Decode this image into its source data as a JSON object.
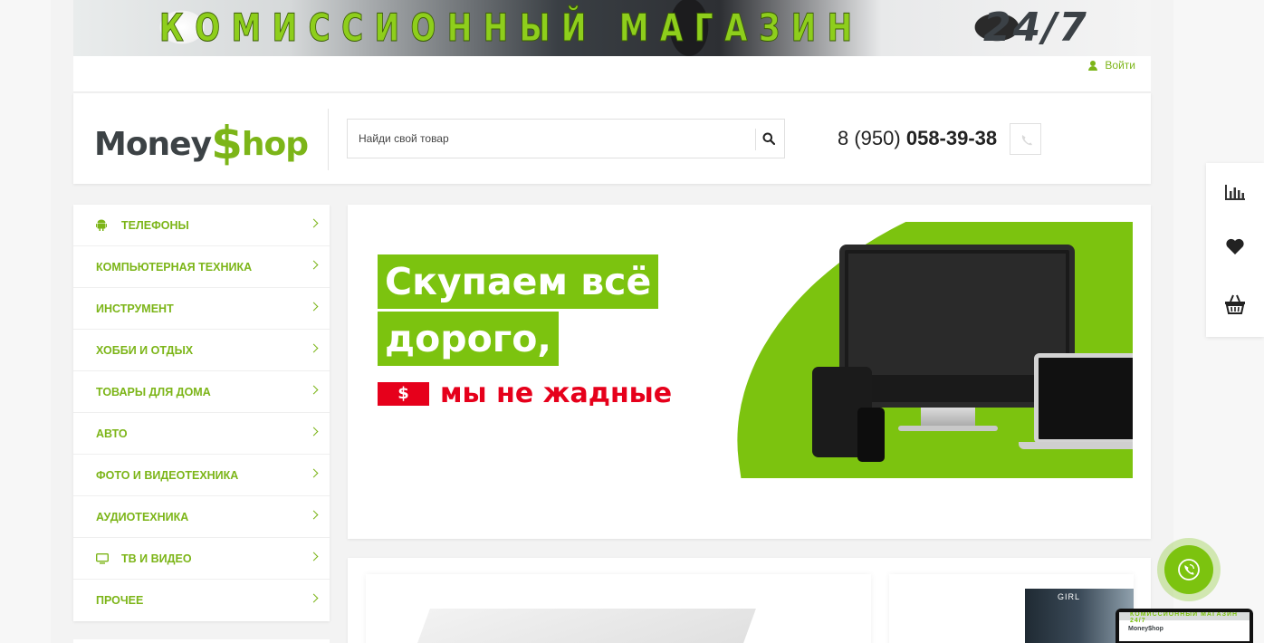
{
  "banner": {
    "title": "КОМИССИОННЫЙ МАГАЗИН",
    "hours": "24/7"
  },
  "topbar": {
    "login_label": "Войти"
  },
  "header": {
    "logo_money": "Money",
    "logo_dollar": "$",
    "logo_hop": "hop",
    "search_placeholder": "Найди свой товар",
    "phone_prefix": "8 (950)",
    "phone_main": "058-39-38"
  },
  "sidebar": {
    "items": [
      {
        "label": "ТЕЛЕФОНЫ",
        "icon": "android-icon"
      },
      {
        "label": "КОМПЬЮТЕРНАЯ ТЕХНИКА",
        "icon": ""
      },
      {
        "label": "ИНСТРУМЕНТ",
        "icon": ""
      },
      {
        "label": "ХОББИ И ОТДЫХ",
        "icon": ""
      },
      {
        "label": "ТОВАРЫ ДЛЯ ДОМА",
        "icon": ""
      },
      {
        "label": "АВТО",
        "icon": ""
      },
      {
        "label": "ФОТО И ВИДЕОТЕХНИКА",
        "icon": ""
      },
      {
        "label": "АУДИОТЕХНИКА",
        "icon": ""
      },
      {
        "label": "ТВ И ВИДЕО",
        "icon": "tv-icon"
      },
      {
        "label": "ПРОЧЕЕ",
        "icon": ""
      }
    ]
  },
  "promo": {
    "line1": "Скупаем всё",
    "line2": "дорого,",
    "tag": "$",
    "line3": "мы не жадные"
  },
  "products": {
    "card2_label": "GIRL"
  },
  "thumb": {
    "banner": "КОМИССИОННЫЙ МАГАЗИН 24/7",
    "logo": "Money$hop"
  },
  "colors": {
    "accent": "#7cb518",
    "promo_green": "#7cc30f",
    "promo_red": "#e6001b",
    "text_dark": "#3c4245"
  },
  "icons": {
    "rightbar": [
      "bar-chart-icon",
      "heart-icon",
      "basket-icon"
    ],
    "call": "viber-phone-icon",
    "search": "search-icon",
    "phone": "phone-icon",
    "user": "user-icon"
  }
}
